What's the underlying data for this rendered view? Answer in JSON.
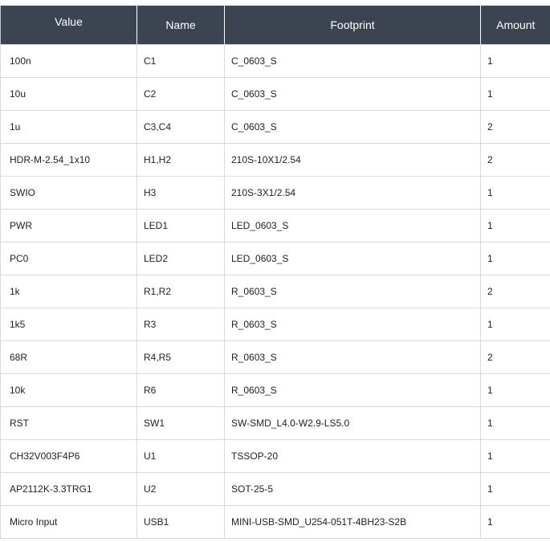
{
  "table": {
    "headers": {
      "value": "Value",
      "name": "Name",
      "footprint": "Footprint",
      "amount": "Amount"
    },
    "rows": [
      {
        "value": "100n",
        "name": "C1",
        "footprint": "C_0603_S",
        "amount": "1"
      },
      {
        "value": "10u",
        "name": "C2",
        "footprint": "C_0603_S",
        "amount": "1"
      },
      {
        "value": "1u",
        "name": "C3,C4",
        "footprint": "C_0603_S",
        "amount": "2"
      },
      {
        "value": "HDR-M-2.54_1x10",
        "name": "H1,H2",
        "footprint": "210S-10X1/2.54",
        "amount": "2"
      },
      {
        "value": "SWIO",
        "name": "H3",
        "footprint": "210S-3X1/2.54",
        "amount": "1"
      },
      {
        "value": "PWR",
        "name": "LED1",
        "footprint": "LED_0603_S",
        "amount": "1"
      },
      {
        "value": "PC0",
        "name": "LED2",
        "footprint": "LED_0603_S",
        "amount": "1"
      },
      {
        "value": "1k",
        "name": "R1,R2",
        "footprint": "R_0603_S",
        "amount": "2"
      },
      {
        "value": "1k5",
        "name": "R3",
        "footprint": "R_0603_S",
        "amount": "1"
      },
      {
        "value": "68R",
        "name": "R4,R5",
        "footprint": "R_0603_S",
        "amount": "2"
      },
      {
        "value": "10k",
        "name": "R6",
        "footprint": "R_0603_S",
        "amount": "1"
      },
      {
        "value": "RST",
        "name": "SW1",
        "footprint": "SW-SMD_L4.0-W2.9-LS5.0",
        "amount": "1"
      },
      {
        "value": "CH32V003F4P6",
        "name": "U1",
        "footprint": "TSSOP-20",
        "amount": "1"
      },
      {
        "value": "AP2112K-3.3TRG1",
        "name": "U2",
        "footprint": "SOT-25-5",
        "amount": "1"
      },
      {
        "value": "Micro Input",
        "name": "USB1",
        "footprint": "MINI-USB-SMD_U254-051T-4BH23-S2B",
        "amount": "1"
      }
    ]
  },
  "colors": {
    "header_bg": "#3b4450",
    "link": "#4a86c8",
    "text": "#222222",
    "border": "#d9d9d9"
  }
}
